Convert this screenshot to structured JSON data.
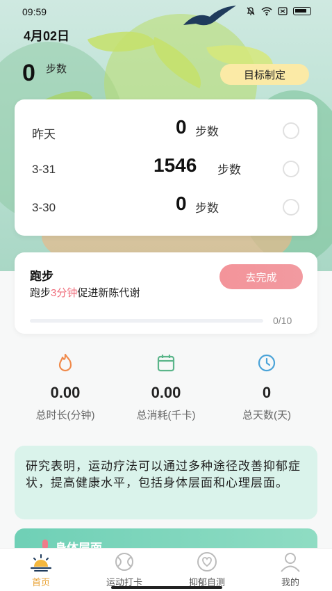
{
  "status_bar": {
    "time": "09:59"
  },
  "header": {
    "date": "4月02日",
    "today_steps": "0",
    "steps_unit": "步数",
    "goal_button": "目标制定"
  },
  "history": [
    {
      "label": "昨天",
      "value": "0",
      "unit": "步数"
    },
    {
      "label": "3-31",
      "value": "1546",
      "unit": "步数"
    },
    {
      "label": "3-30",
      "value": "0",
      "unit": "步数"
    }
  ],
  "task": {
    "title": "跑步",
    "desc_prefix": "跑步",
    "desc_highlight": "3分钟",
    "desc_suffix": "促进新陈代谢",
    "button": "去完成",
    "progress_text": "0/10",
    "progress": 0
  },
  "stats": [
    {
      "value": "0.00",
      "caption": "总时长(分钟)",
      "icon": "flame-icon"
    },
    {
      "value": "0.00",
      "caption": "总消耗(千卡)",
      "icon": "calendar-icon"
    },
    {
      "value": "0",
      "caption": "总天数(天)",
      "icon": "clock-icon"
    }
  ],
  "info": {
    "text": "研究表明，运动疗法可以通过多种途径改善抑郁症状，提高健康水平，包括身体层面和心理层面。"
  },
  "section_peek": {
    "title": "身体层面"
  },
  "nav": [
    {
      "label": "首页",
      "icon": "home-sun-icon",
      "active": true
    },
    {
      "label": "运动打卡",
      "icon": "ball-icon",
      "active": false
    },
    {
      "label": "抑郁自测",
      "icon": "heart-icon",
      "active": false
    },
    {
      "label": "我的",
      "icon": "user-icon",
      "active": false
    }
  ],
  "colors": {
    "accent_pink": "#ef6d7b",
    "goal_yellow": "#fbeaa6",
    "nav_active": "#e9a233",
    "info_bg": "#daf3eb"
  }
}
